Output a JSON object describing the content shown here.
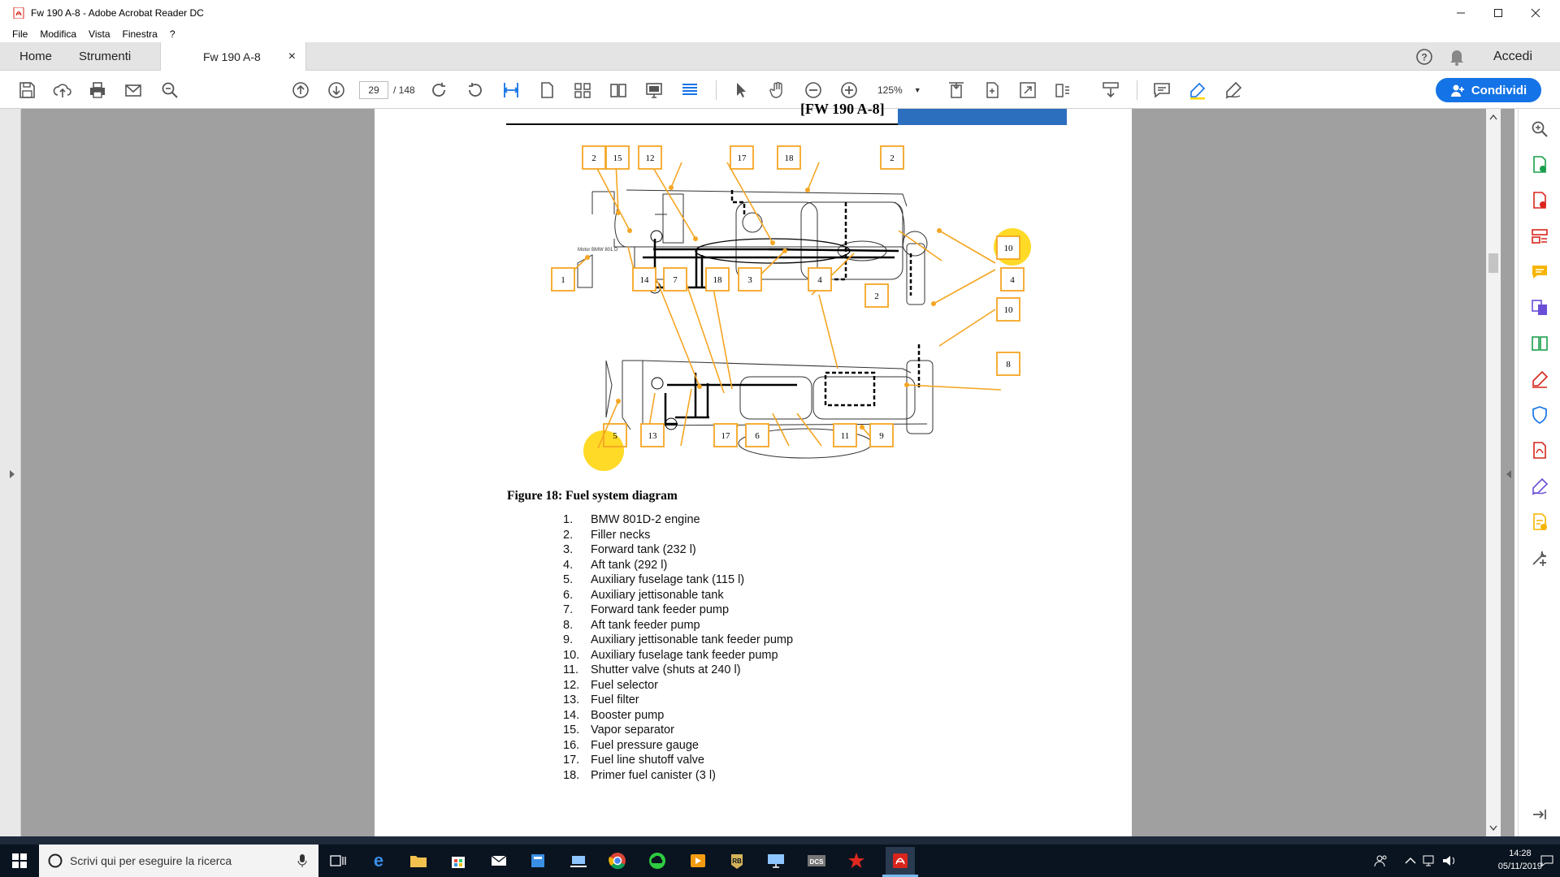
{
  "window": {
    "title": "Fw 190 A-8 - Adobe Acrobat Reader DC"
  },
  "menu": [
    "File",
    "Modifica",
    "Vista",
    "Finestra",
    "?"
  ],
  "tabs": {
    "home": "Home",
    "tools": "Strumenti",
    "doc": "Fw 190 A-8",
    "close": "×"
  },
  "header": {
    "signin": "Accedi"
  },
  "toolbar": {
    "page_current": "29",
    "page_total": "/ 148",
    "zoom": "125%",
    "share": "Condividi"
  },
  "document": {
    "header_text": "[FW 190 A-8]",
    "figure_caption": "Figure 18: Fuel system diagram",
    "callouts": [
      "2",
      "15",
      "12",
      "17",
      "18",
      "2",
      "10",
      "1",
      "14",
      "7",
      "18",
      "3",
      "4",
      "2",
      "4",
      "10",
      "8",
      "5",
      "13",
      "17",
      "6",
      "11",
      "9"
    ],
    "legend": [
      {
        "n": "1.",
        "t": "BMW 801D-2 engine"
      },
      {
        "n": "2.",
        "t": "Filler necks"
      },
      {
        "n": "3.",
        "t": "Forward tank (232 l)"
      },
      {
        "n": "4.",
        "t": "Aft tank (292 l)"
      },
      {
        "n": "5.",
        "t": "Auxiliary fuselage tank (115 l)"
      },
      {
        "n": "6.",
        "t": "Auxiliary jettisonable tank"
      },
      {
        "n": "7.",
        "t": "Forward tank feeder pump"
      },
      {
        "n": "8.",
        "t": "Aft tank feeder pump"
      },
      {
        "n": "9.",
        "t": "Auxiliary jettisonable tank feeder pump"
      },
      {
        "n": "10.",
        "t": "Auxiliary fuselage tank feeder pump"
      },
      {
        "n": "11.",
        "t": "Shutter valve (shuts at 240 l)"
      },
      {
        "n": "12.",
        "t": "Fuel selector"
      },
      {
        "n": "13.",
        "t": "Fuel filter"
      },
      {
        "n": "14.",
        "t": "Booster pump"
      },
      {
        "n": "15.",
        "t": "Vapor separator"
      },
      {
        "n": "16.",
        "t": "Fuel pressure gauge"
      },
      {
        "n": "17.",
        "t": "Fuel line shutoff valve"
      },
      {
        "n": "18.",
        "t": "Primer fuel canister (3 l)"
      }
    ]
  },
  "taskbar": {
    "search_placeholder": "Scrivi qui per eseguire la ricerca",
    "time": "14:28",
    "date": "05/11/2019"
  },
  "colors": {
    "accent": "#1473e6",
    "callout": "#f5a623",
    "highlight": "#ffd400"
  }
}
